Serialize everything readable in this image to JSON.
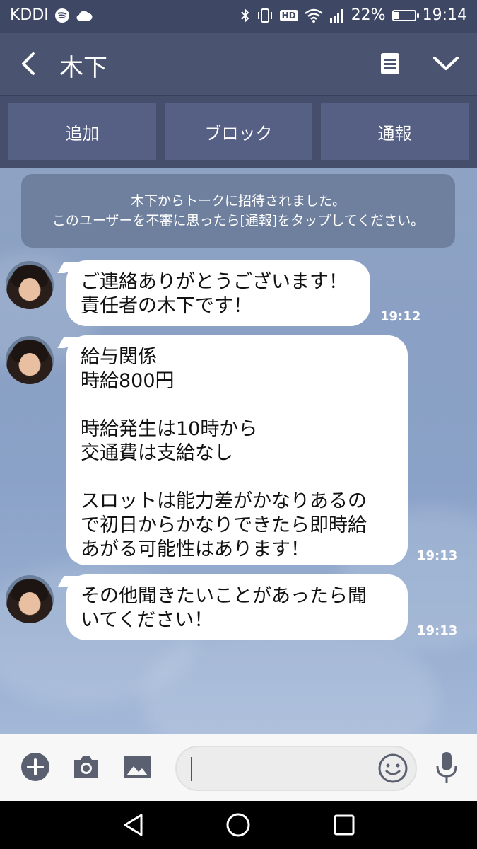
{
  "status_bar": {
    "carrier": "KDDI",
    "battery_percent_label": "22%",
    "battery_level": 0.22,
    "time": "19:14",
    "hd_label": "HD"
  },
  "header": {
    "title": "木下"
  },
  "actions": {
    "add": "追加",
    "block": "ブロック",
    "report": "通報"
  },
  "notice": {
    "line1": "木下からトークに招待されました。",
    "line2": "このユーザーを不審に思ったら[通報]をタップしてください。"
  },
  "messages": [
    {
      "text": "ご連絡ありがとうございます！\n責任者の木下です！",
      "time": "19:12"
    },
    {
      "text": "給与関係\n時給800円\n\n時給発生は10時から\n交通費は支給なし\n\nスロットは能力差がかなりあるの\nで初日からかなりできたら即時給\nあがる可能性はあります！",
      "time": "19:13"
    },
    {
      "text": "その他聞きたいことがあったら聞\nいてください！",
      "time": "19:13"
    }
  ],
  "input": {
    "placeholder": ""
  },
  "colors": {
    "header_bg": "#4a5370",
    "action_button_bg": "#566085",
    "chat_bg": "#8ea3c3",
    "bubble_bg": "#ffffff"
  }
}
